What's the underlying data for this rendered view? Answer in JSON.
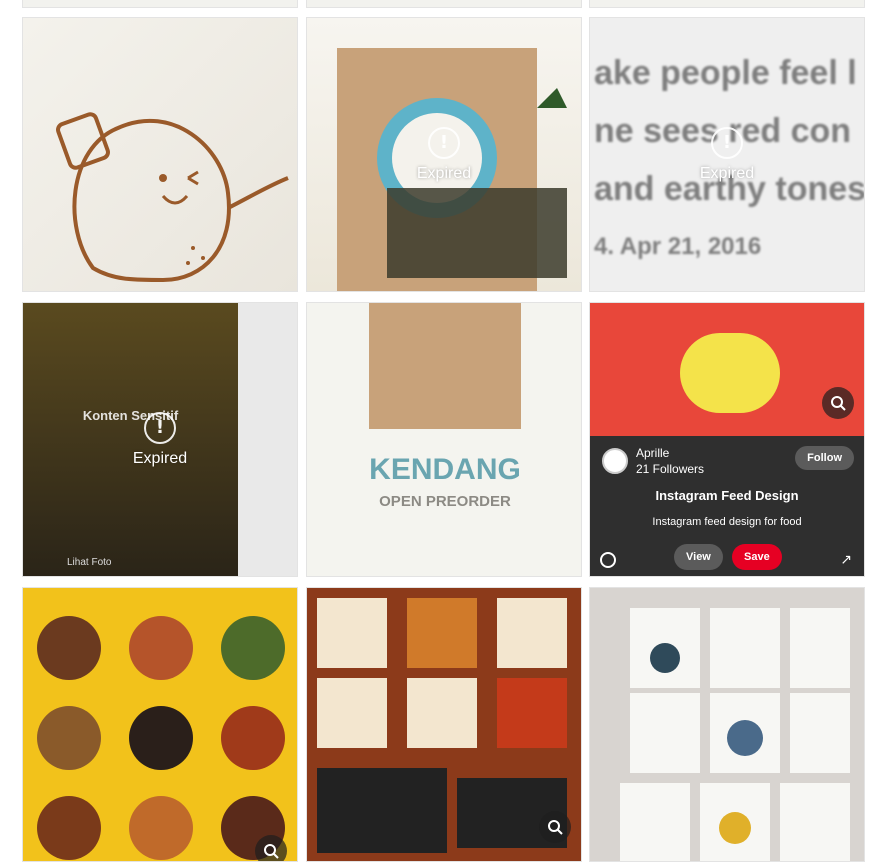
{
  "expired_label": "Expired",
  "sensitive_label": "Konten Sensitif",
  "lihat_foto": "Lihat Foto",
  "pin": {
    "name": "Aprille",
    "followers": "21 Followers",
    "follow_label": "Follow",
    "title": "Instagram Feed Design",
    "description": "Instagram feed design for food",
    "view_label": "View",
    "save_label": "Save"
  },
  "kendang_title": "KENDANG",
  "kendang_subtitle": "OPEN PREORDER",
  "blur_lines": [
    "ake people feel l",
    "ne sees red con",
    "and earthy tones",
    "4. Apr 21, 2016"
  ],
  "colors": {
    "accent_red": "#e60023",
    "food_yellow": "#f2c21b",
    "food_brown": "#8c3a1a",
    "potato_stroke": "#9a5a2a"
  },
  "icons": [
    "alert-icon",
    "visual-search-icon",
    "eye-off-icon",
    "comment-icon",
    "share-icon"
  ]
}
